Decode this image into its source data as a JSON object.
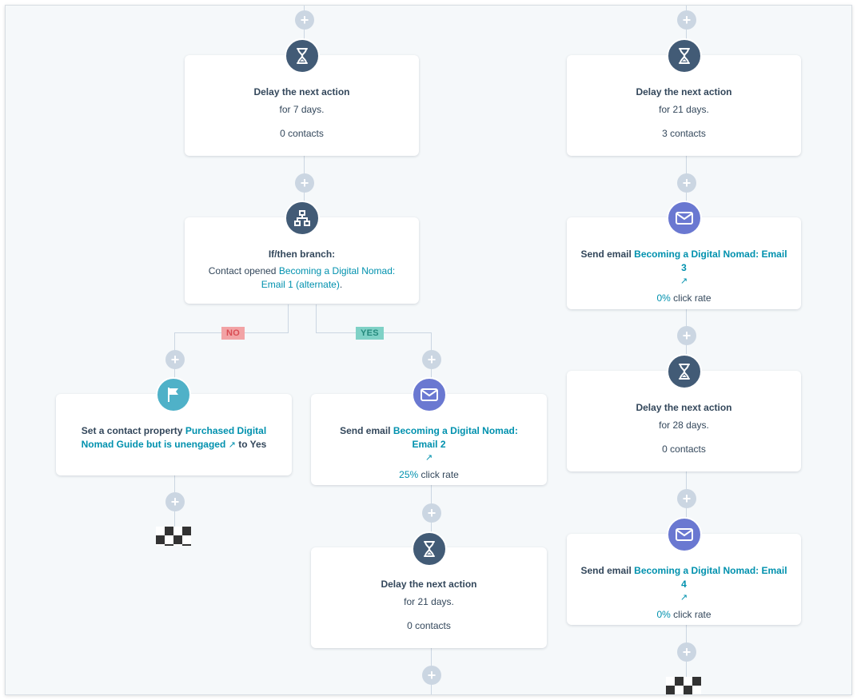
{
  "icons": {
    "delay": "hourglass-icon",
    "branch": "branch-icon",
    "email": "envelope-icon",
    "property": "flag-icon",
    "add": "plus-icon",
    "end": "checkered-flag-icon",
    "external": "external-link-icon"
  },
  "colors": {
    "dark_badge": "#425b76",
    "email_badge": "#6a78d1",
    "property_badge": "#4fb1c8",
    "link": "#0091ae",
    "no_tag": "#f2a3a5",
    "yes_tag": "#7fd1c6"
  },
  "plus_label": "+",
  "external_glyph": "↗",
  "delay1": {
    "title": "Delay the next action",
    "duration": "for 7 days.",
    "contacts": "0 contacts"
  },
  "branch": {
    "title": "If/then branch:",
    "prefix": "Contact opened",
    "email_name": "Becoming a Digital Nomad: Email 1 (alternate)",
    "suffix": "."
  },
  "tags": {
    "no": "NO",
    "yes": "YES"
  },
  "property": {
    "prefix": "Set a contact property",
    "name": "Purchased Digital Nomad Guide but is unengaged",
    "suffix": "to Yes"
  },
  "email2": {
    "prefix": "Send email",
    "name": "Becoming a Digital Nomad: Email 2",
    "rate_value": "25%",
    "rate_label": "click rate"
  },
  "delay_mid": {
    "title": "Delay the next action",
    "duration": "for 21 days.",
    "contacts": "0 contacts"
  },
  "right_delay1": {
    "title": "Delay the next action",
    "duration": "for 21 days.",
    "contacts": "3 contacts"
  },
  "email3": {
    "prefix": "Send email",
    "name": "Becoming a Digital Nomad: Email 3",
    "rate_value": "0%",
    "rate_label": "click rate"
  },
  "right_delay2": {
    "title": "Delay the next action",
    "duration": "for 28 days.",
    "contacts": "0 contacts"
  },
  "email4": {
    "prefix": "Send email",
    "name": "Becoming a Digital Nomad: Email 4",
    "rate_value": "0%",
    "rate_label": "click rate"
  }
}
